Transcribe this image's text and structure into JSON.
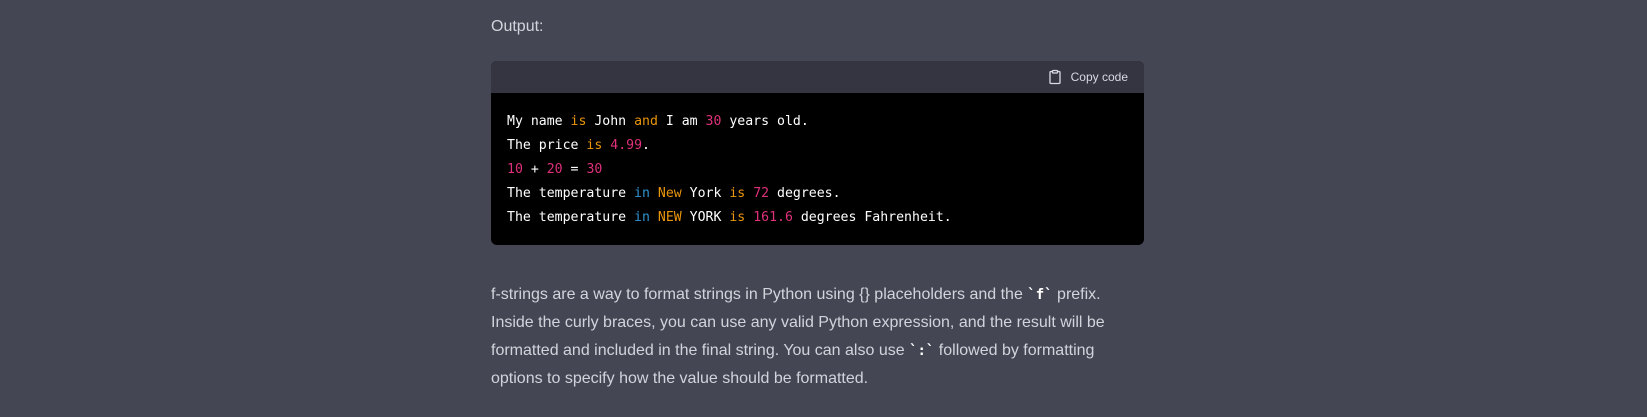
{
  "output_label": "Output:",
  "code_block": {
    "copy_label": "Copy code",
    "copy_icon": "clipboard-icon",
    "lines": [
      [
        {
          "t": "My name ",
          "c": "plain"
        },
        {
          "t": "is",
          "c": "kw"
        },
        {
          "t": " John ",
          "c": "plain"
        },
        {
          "t": "and",
          "c": "kw"
        },
        {
          "t": " I am ",
          "c": "plain"
        },
        {
          "t": "30",
          "c": "num"
        },
        {
          "t": " years old.",
          "c": "plain"
        }
      ],
      [
        {
          "t": "The price ",
          "c": "plain"
        },
        {
          "t": "is",
          "c": "kw"
        },
        {
          "t": " ",
          "c": "plain"
        },
        {
          "t": "4.99",
          "c": "num"
        },
        {
          "t": ".",
          "c": "plain"
        }
      ],
      [
        {
          "t": "10",
          "c": "num"
        },
        {
          "t": " + ",
          "c": "plain"
        },
        {
          "t": "20",
          "c": "num"
        },
        {
          "t": " = ",
          "c": "plain"
        },
        {
          "t": "30",
          "c": "num"
        }
      ],
      [
        {
          "t": "The temperature ",
          "c": "plain"
        },
        {
          "t": "in",
          "c": "bl"
        },
        {
          "t": " ",
          "c": "plain"
        },
        {
          "t": "New",
          "c": "kw"
        },
        {
          "t": " York ",
          "c": "plain"
        },
        {
          "t": "is",
          "c": "kw"
        },
        {
          "t": " ",
          "c": "plain"
        },
        {
          "t": "72",
          "c": "num"
        },
        {
          "t": " degrees.",
          "c": "plain"
        }
      ],
      [
        {
          "t": "The temperature ",
          "c": "plain"
        },
        {
          "t": "in",
          "c": "bl"
        },
        {
          "t": " ",
          "c": "plain"
        },
        {
          "t": "NEW",
          "c": "kw"
        },
        {
          "t": " YORK ",
          "c": "plain"
        },
        {
          "t": "is",
          "c": "kw"
        },
        {
          "t": " ",
          "c": "plain"
        },
        {
          "t": "161.6",
          "c": "num"
        },
        {
          "t": " degrees Fahrenheit.",
          "c": "plain"
        }
      ]
    ]
  },
  "paragraph": {
    "part1": "f-strings are a way to format strings in Python using {} placeholders and the ",
    "code1": "`f`",
    "part2": " prefix. Inside the curly braces, you can use any valid Python expression, and the result will be formatted and included in the final string. You can also use ",
    "code2": "`:`",
    "part3": " followed by formatting options to specify how the value should be formatted."
  },
  "colors": {
    "page_bg": "#444654",
    "code_bg": "#000000",
    "code_header_bg": "#343541",
    "keyword": "#e9950c",
    "number": "#df3079",
    "builtin": "#2e95d3"
  }
}
